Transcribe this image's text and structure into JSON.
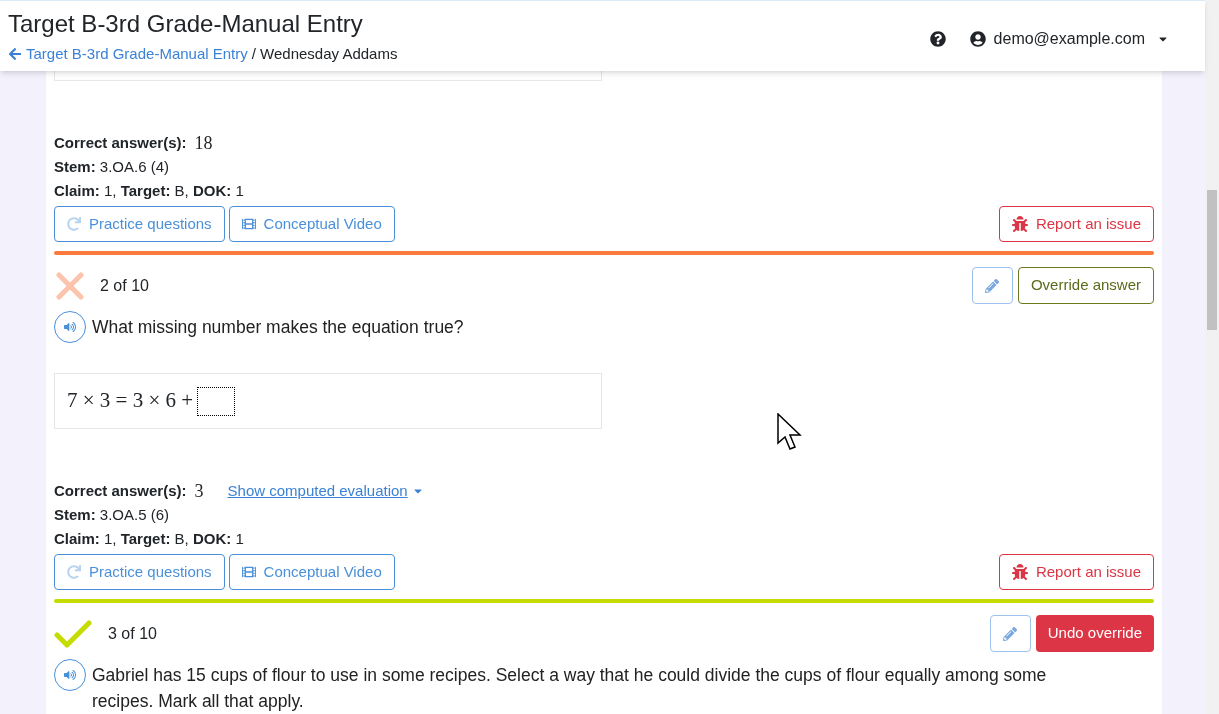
{
  "header": {
    "title": "Target B-3rd Grade-Manual Entry",
    "back_link": "Target B-3rd Grade-Manual Entry",
    "current": "/ Wednesday Addams",
    "user": "demo@example.com"
  },
  "sections": [
    {
      "kind": "answer_box"
    },
    {
      "kind": "details",
      "correct_label": "Correct answer(s):",
      "correct_answer": "18",
      "stem": "**Stem:** 3.OA.6 (4)",
      "meta": "**Claim:** 1, **Target:** B, **DOK:** 1",
      "practice": "Practice questions",
      "video": "Conceptual Video",
      "report": "Report an issue"
    },
    {
      "kind": "question",
      "correct": false,
      "position": "2 of 10",
      "action": {
        "kind": "override",
        "label": "Override answer"
      },
      "prompt": "What missing number makes the equation true?",
      "equation": "7 × 3 = 3 × 6 +"
    },
    {
      "kind": "details",
      "correct_label": "Correct answer(s):",
      "correct_answer": "3",
      "evaluation_link": "Show computed evaluation",
      "stem": "**Stem:** 3.OA.5 (6)",
      "meta": "**Claim:** 1, **Target:** B, **DOK:** 1",
      "practice": "Practice questions",
      "video": "Conceptual Video",
      "report": "Report an issue"
    },
    {
      "kind": "question",
      "correct": true,
      "position": "3 of 10",
      "action": {
        "kind": "undo",
        "label": "Undo override"
      },
      "prompt": "Gabriel has 15 cups of flour to use in some recipes. Select a way that he could divide the cups of flour equally among some recipes. Mark all that apply."
    }
  ]
}
